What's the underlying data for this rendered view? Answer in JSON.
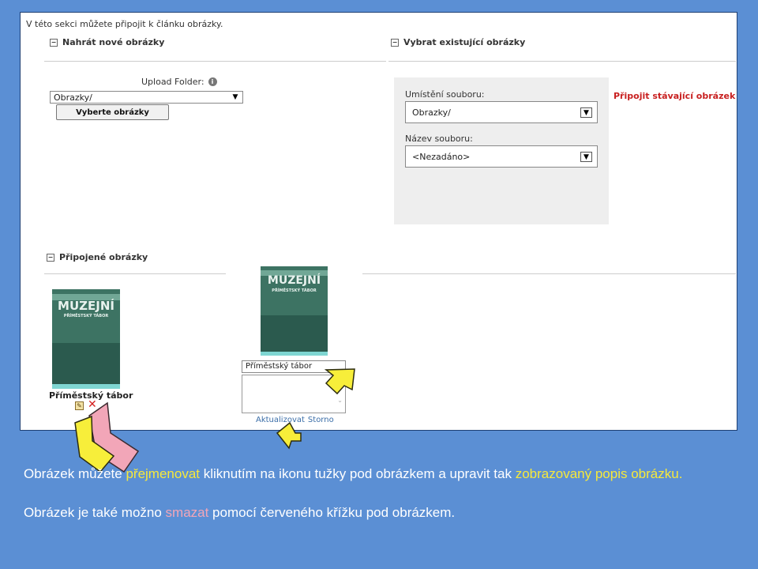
{
  "intro_text": "V této sekci můžete připojit k článku obrázky.",
  "upload_section": {
    "header": "Nahrát nové obrázky",
    "folder_label": "Upload Folder:",
    "folder_value": "Obrazky/",
    "choose_button": "Vyberte obrázky"
  },
  "existing_section": {
    "header": "Vybrat existující obrázky",
    "location_label": "Umístění souboru:",
    "location_value": "Obrazky/",
    "filename_label": "Název souboru:",
    "filename_value": "<Nezadáno>",
    "attach_link": "Připojit stávající obrázek"
  },
  "attached_section": {
    "header": "Připojené obrázky",
    "image_caption": "Příměstský tábor",
    "poster_text": "MUZEJNÍ",
    "poster_subtext": "PŘÍMĚSTSKÝ TÁBOR",
    "edit_field_value": "Příměstský tábor",
    "update_link": "Aktualizovat",
    "cancel_link": "Storno"
  },
  "caption": {
    "line1_parts": [
      "Obrázek můžete ",
      "přejmenovat",
      " kliknutím na ikonu tužky pod obrázkem a upravit tak ",
      "zobrazovaný popis obrázku",
      "."
    ],
    "line2_parts": [
      "Obrázek je také možno ",
      "smazat",
      " pomocí červeného křížku pod obrázkem."
    ]
  },
  "colors": {
    "slide_background": "#5b8fd4",
    "highlight_yellow": "#f7e93a",
    "highlight_pink": "#f2a6b8",
    "link_red": "#c82020",
    "link_blue": "#3b6ea8"
  },
  "icons": [
    "info-icon",
    "pencil-icon",
    "delete-x-icon",
    "collapse-icon",
    "yellow-arrow",
    "pink-arrow",
    "chevron-down-icon"
  ]
}
